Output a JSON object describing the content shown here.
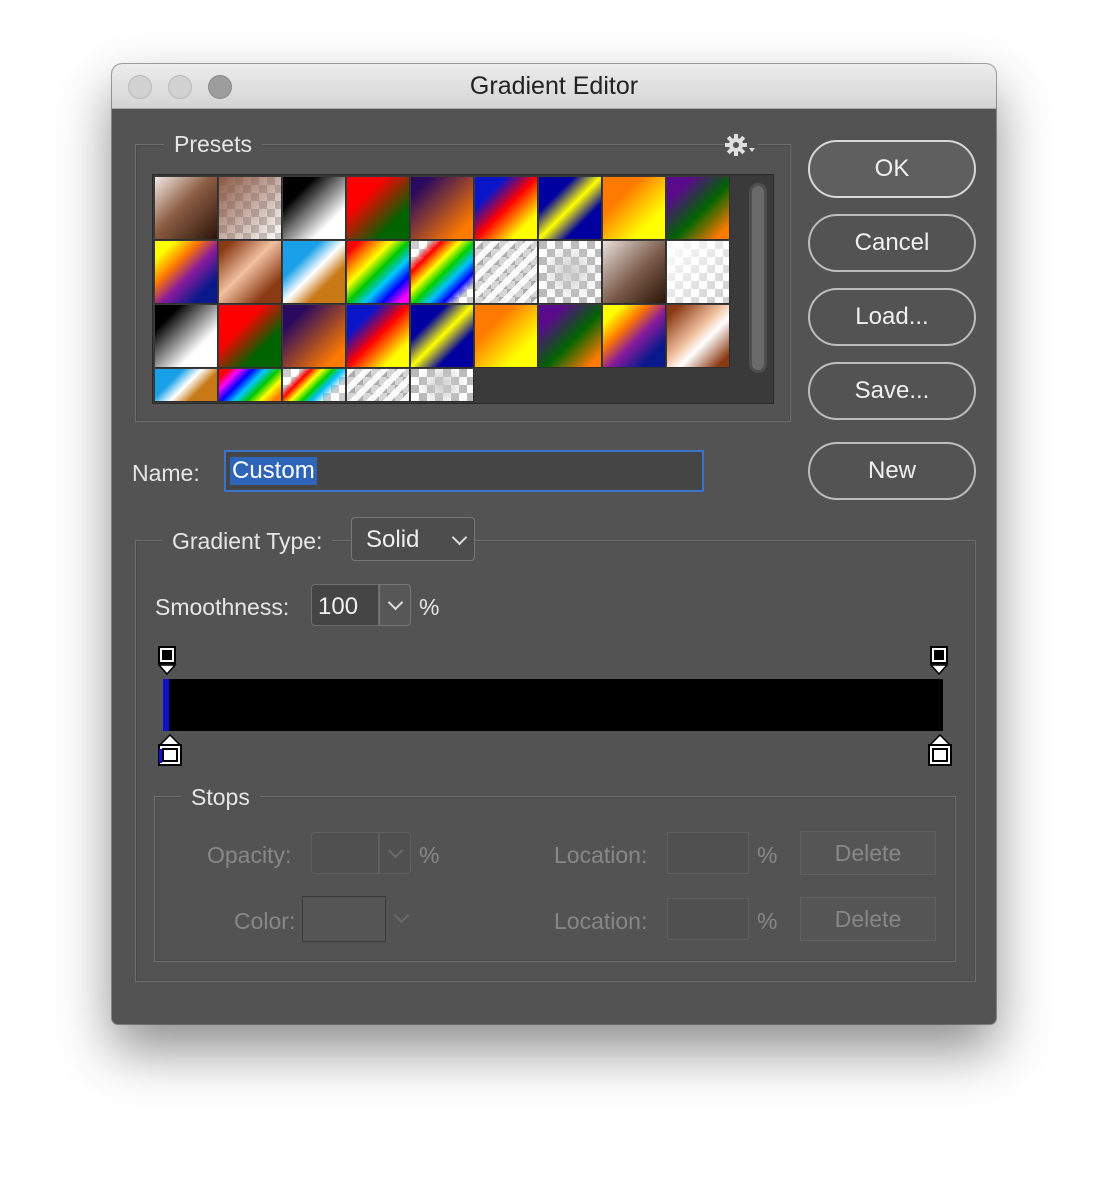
{
  "window": {
    "title": "Gradient Editor"
  },
  "presets": {
    "label": "Presets",
    "menu_icon": "gear-icon",
    "swatches": [
      "linear-gradient(135deg,#f2e9e4 0%,#8d5e44 45%,#2b140a 100%)",
      "linear-gradient(135deg,rgba(140,90,70,1) 0%,rgba(140,90,70,0) 100%),repeating-conic-gradient(#fff 0 25%,#ccc 0 50%) 0 0/16px 16px",
      "linear-gradient(135deg,#000 25%,#fff 75%)",
      "linear-gradient(135deg,#ff0000 30%,#006400 75%)",
      "linear-gradient(135deg,#2a0a5e 15%,#ff7a00 85%)",
      "linear-gradient(135deg,#0a14c8 25%,#ff0000 50%,#ffff00 80%)",
      "linear-gradient(135deg,#0000a0 28%,#ffff00 50%,#0000a0 72%)",
      "linear-gradient(135deg,#ff7a00 30%,#ffff00 75%)",
      "linear-gradient(135deg,#5a0a8c 20%,#006400 55%,#ff7a00 90%)",
      "linear-gradient(135deg,#ffff00 15%,#ff7a00 35%,#8a1a9c 55%,#0a1a8c 80%)",
      "linear-gradient(135deg,#8c3a14 10%,#f0c0a0 45%,#8c3a14 80%)",
      "linear-gradient(135deg,#1aa0e8 30%,#ffffff 50%,#c87814 70%)",
      "linear-gradient(135deg,#ff0000 10%,#ff7a00 22%,#ffff00 36%,#00c800 50%,#00c8ff 64%,#0000ff 78%,#ff00ff 92%)",
      "linear-gradient(135deg,transparent 15%,#ff0000 25%,#ffff00 40%,#00d000 52%,#00c0ff 64%,#0000ff 76%,transparent 86%),repeating-conic-gradient(#fff 0 25%,#ccc 0 50%) 0 0/16px 16px",
      "repeating-linear-gradient(135deg,rgba(255,255,255,0.9) 0 6px,rgba(150,150,150,0.4) 6px 12px),repeating-conic-gradient(#fff 0 25%,#bbb 0 50%) 0 0/16px 16px",
      "radial-gradient(circle,rgba(200,200,200,0.9),rgba(255,255,255,0) 70%),repeating-conic-gradient(#fff 0 25%,#bbb 0 50%) 0 0/16px 16px",
      "linear-gradient(135deg,#e8e0dc 0%,#7a5a48 55%,#2b1408 100%)",
      "linear-gradient(135deg,rgba(255,255,255,1) 0%,rgba(120,100,90,0) 100%),repeating-conic-gradient(#fff 0 25%,#ccc 0 50%) 0 0/16px 16px",
      "linear-gradient(135deg,#000 20%,#fff 70%)",
      "linear-gradient(135deg,#ff0000 35%,#006400 70%)",
      "linear-gradient(135deg,#2a0a5e 20%,#ff7a00 85%)",
      "linear-gradient(135deg,#0a14c8 25%,#ff0000 50%,#ffff00 80%)",
      "linear-gradient(135deg,#0000a0 28%,#ffff00 50%,#0000a0 72%)",
      "linear-gradient(135deg,#ff7a00 30%,#ffff00 75%)",
      "linear-gradient(135deg,#5a0a8c 20%,#006400 55%,#ff7a00 90%)",
      "linear-gradient(135deg,#ffff00 15%,#ff7a00 35%,#8a1a9c 55%,#0a1a8c 80%)",
      "linear-gradient(135deg,#8c3a14 10%,#f0c0a0 45%,#ffffff 60%,#8c3a14 90%)",
      "linear-gradient(135deg,#1aa0e8 30%,#ffffff 50%,#c87814 70%)",
      "linear-gradient(135deg,#ff0000 10%,#ff00ff 22%,#0000ff 36%,#00c8ff 50%,#00c800 64%,#ffff00 78%,#ff7a00 92%)",
      "linear-gradient(135deg,transparent 20%,#ff0000 30%,#ffff00 42%,#00d000 54%,#00c0ff 64%,transparent 78%),repeating-conic-gradient(#fff 0 25%,#ccc 0 50%) 0 0/16px 16px",
      "repeating-linear-gradient(135deg,rgba(255,255,255,0.9) 0 6px,rgba(150,150,150,0.4) 6px 12px),repeating-conic-gradient(#fff 0 25%,#bbb 0 50%) 0 0/16px 16px",
      "radial-gradient(circle,rgba(200,200,200,0.9),rgba(255,255,255,0) 70%),repeating-conic-gradient(#fff 0 25%,#bbb 0 50%) 0 0/16px 16px"
    ]
  },
  "name_field": {
    "label": "Name:",
    "value": "Custom"
  },
  "buttons": {
    "ok": "OK",
    "cancel": "Cancel",
    "load": "Load...",
    "save": "Save...",
    "new": "New"
  },
  "gradient": {
    "type_label": "Gradient Type:",
    "type_value": "Solid",
    "smoothness_label": "Smoothness:",
    "smoothness_value": "100",
    "smoothness_unit": "%",
    "bar_color": "#000000",
    "stop_highlight": "#1010c8"
  },
  "stops": {
    "label": "Stops",
    "opacity_label": "Opacity:",
    "color_label": "Color:",
    "location_label": "Location:",
    "percent": "%",
    "delete_label": "Delete"
  }
}
